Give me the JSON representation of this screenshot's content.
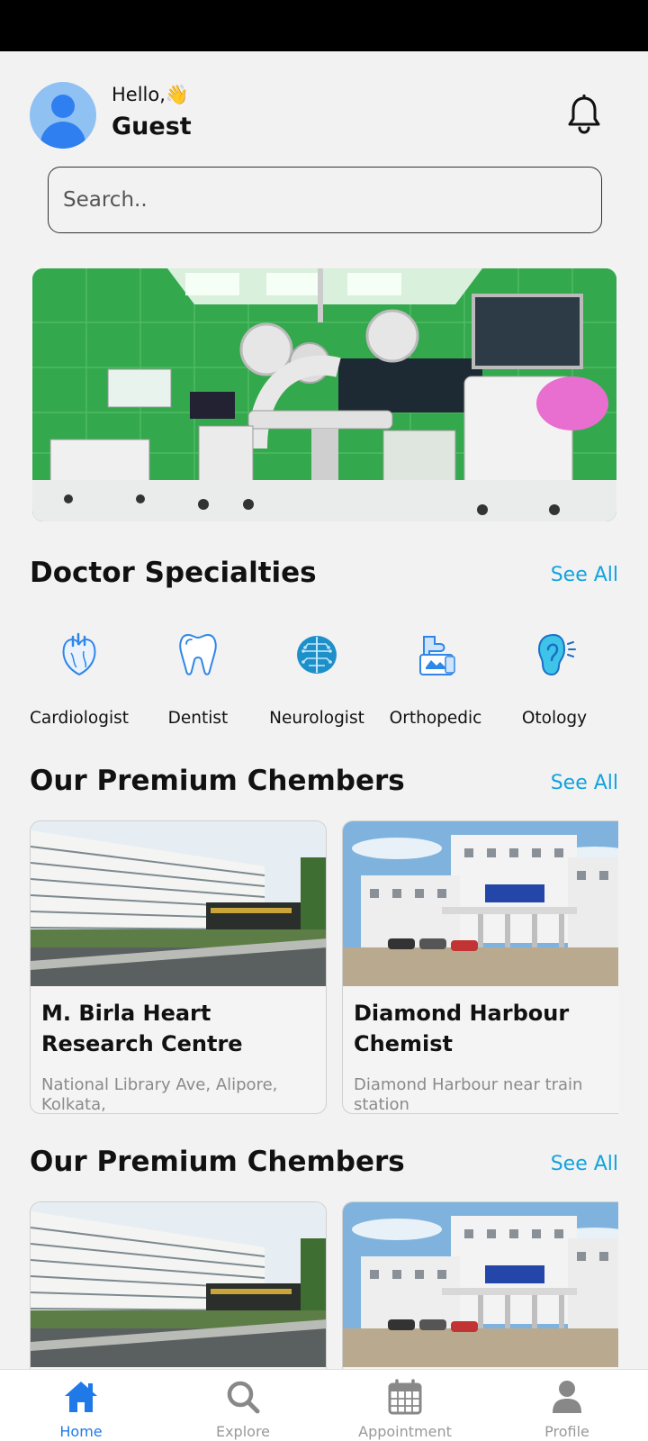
{
  "header": {
    "hello": "Hello,",
    "wave_emoji": "👋",
    "user_name": "Guest"
  },
  "search": {
    "placeholder": "Search..",
    "value": ""
  },
  "specialties": {
    "title": "Doctor Specialties",
    "see_all": "See All",
    "items": [
      {
        "label": "Cardiologist",
        "icon": "heart-icon"
      },
      {
        "label": "Dentist",
        "icon": "tooth-icon"
      },
      {
        "label": "Neurologist",
        "icon": "brain-icon"
      },
      {
        "label": "Orthopedic",
        "icon": "bone-joint-icon"
      },
      {
        "label": "Otology",
        "icon": "ear-icon"
      }
    ]
  },
  "chambers_1": {
    "title": "Our Premium Chembers",
    "see_all": "See All",
    "items": [
      {
        "name": "M. Birla Heart Research Centre",
        "address": "National Library Ave, Alipore, Kolkata,"
      },
      {
        "name": "Diamond Harbour Chemist",
        "address": "Diamond Harbour near train station"
      }
    ]
  },
  "chambers_2": {
    "title": "Our Premium Chembers",
    "see_all": "See All"
  },
  "nav": {
    "items": [
      {
        "label": "Home",
        "icon": "home-icon",
        "active": true
      },
      {
        "label": "Explore",
        "icon": "search-icon",
        "active": false
      },
      {
        "label": "Appointment",
        "icon": "calendar-icon",
        "active": false
      },
      {
        "label": "Profile",
        "icon": "user-icon",
        "active": false
      }
    ]
  },
  "colors": {
    "accent": "#12a3e0",
    "nav_active": "#1f7ae8",
    "icon_blue": "#2f86e8",
    "background": "#f2f2f2"
  }
}
